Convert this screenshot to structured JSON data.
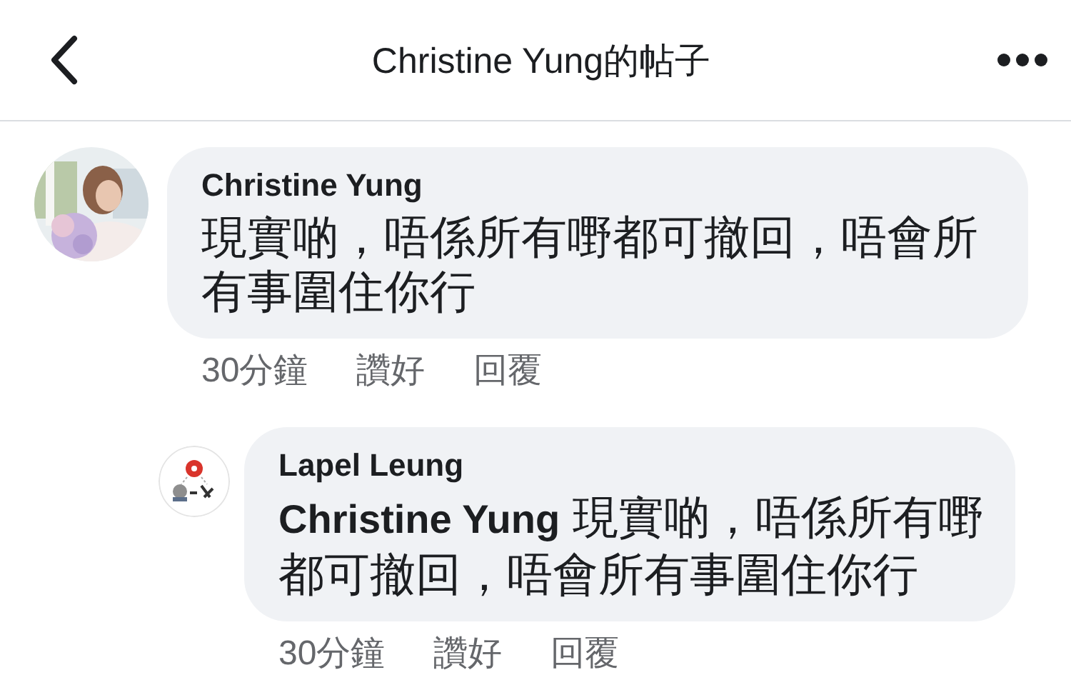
{
  "header": {
    "title": "Christine Yung的帖子"
  },
  "comments": [
    {
      "author": "Christine Yung",
      "avatar": {
        "kind": "picture"
      },
      "text": "現實啲，唔係所有嘢都可撤回，唔會所有事圍住你行",
      "time": "30分鐘",
      "actions": [
        "讚好",
        "回覆"
      ],
      "replies": [
        {
          "author": "Lapel Leung",
          "avatar": {
            "kind": "emblem"
          },
          "text": "**Christine Yung** 現實啲，唔係所有嘢都可撤回，唔會所有事圍住你行",
          "time": "30分鐘",
          "actions": [
            "讚好",
            "回覆"
          ]
        }
      ]
    }
  ]
}
